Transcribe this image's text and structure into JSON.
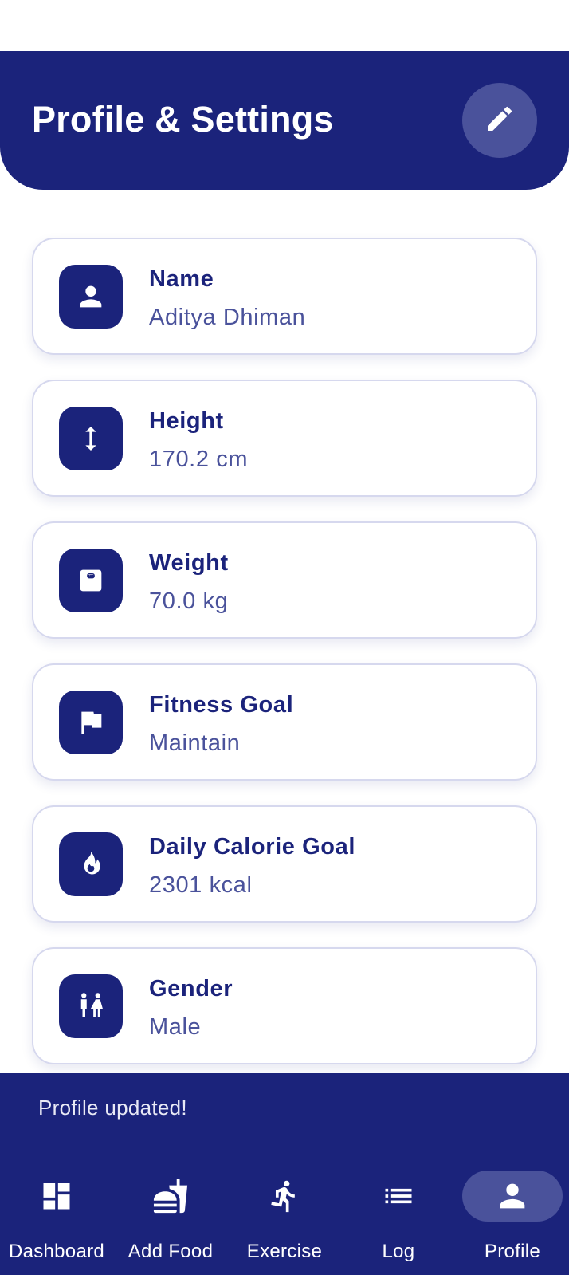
{
  "header": {
    "title": "Profile & Settings",
    "edit_icon": "pencil-icon"
  },
  "cards": [
    {
      "label": "Name",
      "value": "Aditya Dhiman",
      "icon": "person-icon"
    },
    {
      "label": "Height",
      "value": "170.2 cm",
      "icon": "height-arrows-icon"
    },
    {
      "label": "Weight",
      "value": "70.0 kg",
      "icon": "scale-icon"
    },
    {
      "label": "Fitness Goal",
      "value": "Maintain",
      "icon": "flag-icon"
    },
    {
      "label": "Daily Calorie Goal",
      "value": "2301 kcal",
      "icon": "flame-icon"
    },
    {
      "label": "Gender",
      "value": "Male",
      "icon": "wc-icon"
    }
  ],
  "snackbar": {
    "message": "Profile updated!"
  },
  "nav": {
    "active": "Profile",
    "items": [
      {
        "label": "Dashboard",
        "icon": "dashboard-icon"
      },
      {
        "label": "Add Food",
        "icon": "fastfood-icon"
      },
      {
        "label": "Exercise",
        "icon": "running-icon"
      },
      {
        "label": "Log",
        "icon": "list-icon"
      },
      {
        "label": "Profile",
        "icon": "person-icon"
      }
    ]
  },
  "colors": {
    "primary": "#1b237b",
    "primary_light": "#4a529b",
    "card_border": "#d6d8ee",
    "background": "#ffffff"
  }
}
